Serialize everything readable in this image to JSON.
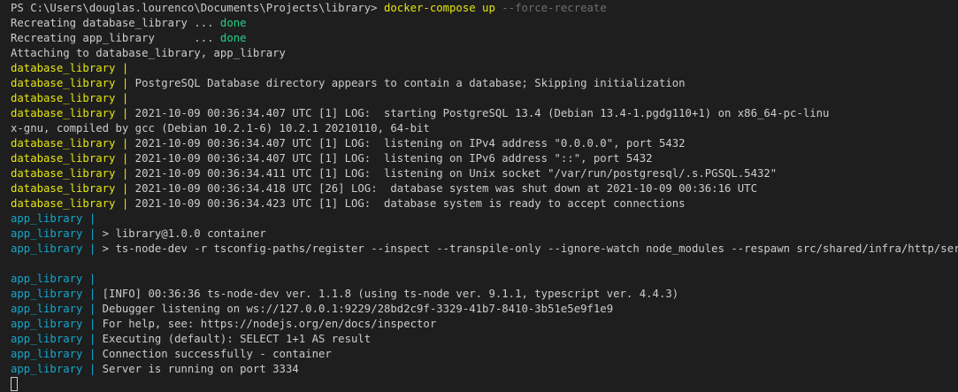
{
  "colors": {
    "background": "#1e1e1e",
    "text": "#cccccc",
    "command": "#e5e510",
    "dim": "#6e6e6e",
    "done": "#23d18b",
    "database_library_prefix": "#e5e510",
    "app_library_prefix": "#11a8cd"
  },
  "prompt": {
    "path": "PS C:\\Users\\douglas.lourenco\\Documents\\Projects\\library> ",
    "command": "docker-compose up",
    "flag": " --force-recreate"
  },
  "recreate": [
    {
      "text": "Recreating database_library ... ",
      "status": "done"
    },
    {
      "text": "Recreating app_library      ... ",
      "status": "done"
    }
  ],
  "attaching": "Attaching to database_library, app_library",
  "db_prefix": "database_library | ",
  "app_prefix": "app_library | ",
  "db_lines": [
    "",
    "PostgreSQL Database directory appears to contain a database; Skipping initialization",
    "",
    "2021-10-09 00:36:34.407 UTC [1] LOG:  starting PostgreSQL 13.4 (Debian 13.4-1.pgdg110+1) on x86_64-pc-linu"
  ],
  "wrap_line": "x-gnu, compiled by gcc (Debian 10.2.1-6) 10.2.1 20210110, 64-bit",
  "db_lines_2": [
    "2021-10-09 00:36:34.407 UTC [1] LOG:  listening on IPv4 address \"0.0.0.0\", port 5432",
    "2021-10-09 00:36:34.407 UTC [1] LOG:  listening on IPv6 address \"::\", port 5432",
    "2021-10-09 00:36:34.411 UTC [1] LOG:  listening on Unix socket \"/var/run/postgresql/.s.PGSQL.5432\"",
    "2021-10-09 00:36:34.418 UTC [26] LOG:  database system was shut down at 2021-10-09 00:36:16 UTC",
    "2021-10-09 00:36:34.423 UTC [1] LOG:  database system is ready to accept connections"
  ],
  "app_lines": [
    "",
    "> library@1.0.0 container",
    "> ts-node-dev -r tsconfig-paths/register --inspect --transpile-only --ignore-watch node_modules --respawn src/shared/infra/http/server.ts"
  ],
  "app_lines_2": [
    "",
    "[INFO] 00:36:36 ts-node-dev ver. 1.1.8 (using ts-node ver. 9.1.1, typescript ver. 4.4.3)",
    "Debugger listening on ws://127.0.0.1:9229/28bd2c9f-3329-41b7-8410-3b51e5e9f1e9",
    "For help, see: https://nodejs.org/en/docs/inspector",
    "Executing (default): SELECT 1+1 AS result",
    "Connection successfully - container",
    "Server is running on port 3334"
  ]
}
